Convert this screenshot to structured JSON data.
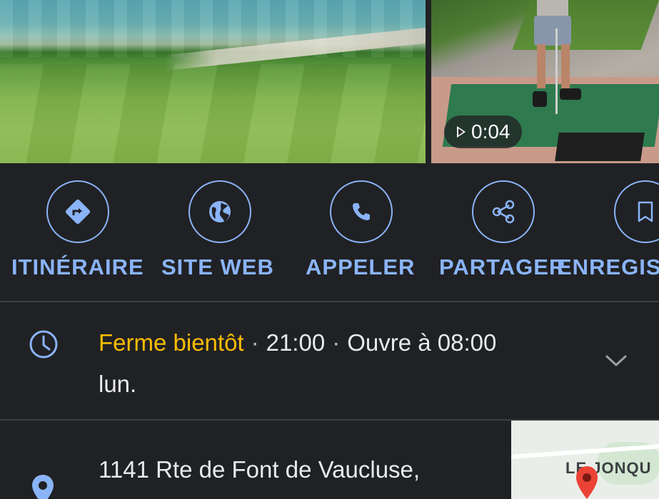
{
  "media": {
    "video_duration": "0:04"
  },
  "actions": [
    {
      "label": "ITINÉRAIRE",
      "icon": "directions-icon"
    },
    {
      "label": "SITE WEB",
      "icon": "globe-icon"
    },
    {
      "label": "APPELER",
      "icon": "phone-icon"
    },
    {
      "label": "PARTAGER",
      "icon": "share-icon"
    },
    {
      "label": "ENREGISTRER",
      "icon": "bookmark-icon"
    }
  ],
  "hours": {
    "status": "Ferme bientôt",
    "separator": "·",
    "close_time": "21:00",
    "next_open": "Ouvre à 08:00",
    "next_day": "lun."
  },
  "address": {
    "line1": "1141 Rte de Font de Vaucluse,"
  },
  "map": {
    "label": "LE JONQU"
  },
  "colors": {
    "accent": "#8ab4f8",
    "status_warning": "#fbbc04",
    "background": "#202124",
    "text": "#e8eaed",
    "map_marker": "#ea4335"
  }
}
